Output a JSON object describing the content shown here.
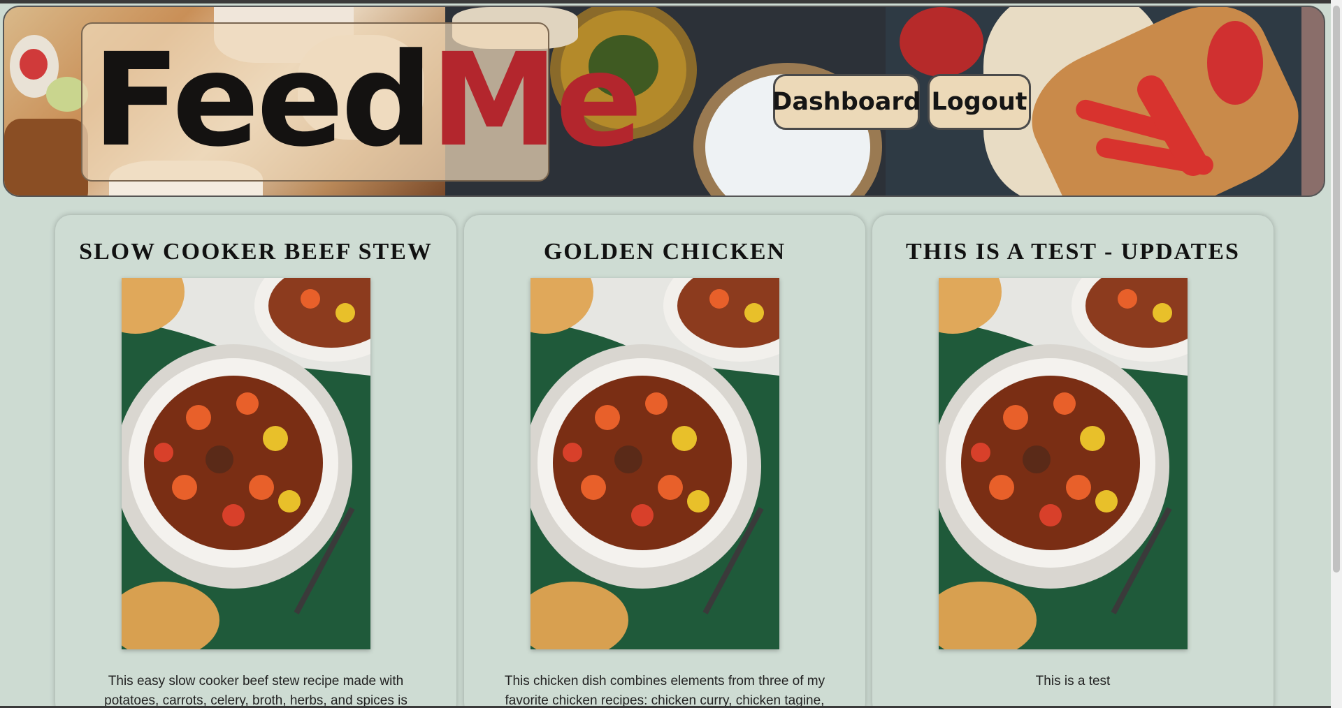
{
  "header": {
    "logo_part1": "Feed",
    "logo_part2": "Me",
    "nav": {
      "dashboard_label": "Dashboard",
      "logout_label": "Logout"
    }
  },
  "cards": [
    {
      "title": "SLOW COOKER BEEF STEW",
      "image_alt": "beef stew in a bowl",
      "description": "This easy slow cooker beef stew recipe made with potatoes, carrots, celery, broth, herbs, and spices is"
    },
    {
      "title": "GOLDEN CHICKEN",
      "image_alt": "beef stew in a bowl",
      "description": "This chicken dish combines elements from three of my favorite chicken recipes: chicken curry, chicken tagine,"
    },
    {
      "title": "THIS IS A TEST - UPDATES",
      "image_alt": "beef stew in a bowl",
      "description": "This is a test"
    }
  ],
  "colors": {
    "page_bg": "#cddbd2",
    "logo_accent": "#b3262d",
    "button_bg": "#ecd9b8"
  }
}
